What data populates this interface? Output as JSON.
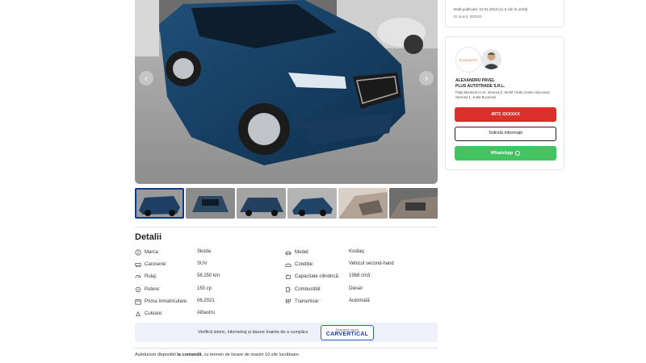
{
  "gallery": {
    "prev_icon": "chevron-left-icon",
    "next_icon": "chevron-right-icon",
    "prev_glyph": "‹",
    "next_glyph": "›",
    "thumbnail_count": 6
  },
  "details": {
    "title": "Detalii",
    "specs": [
      {
        "icon": "info-icon",
        "label": "Marca:",
        "value": "Skoda"
      },
      {
        "icon": "car-icon",
        "label": "Model:",
        "value": "Kodiaq"
      },
      {
        "icon": "car-body-icon",
        "label": "Caroserie:",
        "value": "SUV"
      },
      {
        "icon": "condition-icon",
        "label": "Condiție:",
        "value": "Vehicul second-hand"
      },
      {
        "icon": "odometer-icon",
        "label": "Rulaj:",
        "value": "56.250 km"
      },
      {
        "icon": "engine-icon",
        "label": "Capacitate cilindrică:",
        "value": "1968 cm3"
      },
      {
        "icon": "power-icon",
        "label": "Putere:",
        "value": "150 cp"
      },
      {
        "icon": "fuel-icon",
        "label": "Combustibil:",
        "value": "Diesel"
      },
      {
        "icon": "calendar-icon",
        "label": "Prima înmatriculare:",
        "value": "06.2021"
      },
      {
        "icon": "transmission-icon",
        "label": "Transmisie:",
        "value": "Automată"
      },
      {
        "icon": "color-icon",
        "label": "Culoare:",
        "value": "Albastru"
      }
    ]
  },
  "carvertical": {
    "text": "Verifică istoric, kilometraj și daune înainte de a cumpăra",
    "button_small": "Descarcă raport",
    "button_brand": "CARVERTICAL"
  },
  "delivery_note": {
    "before": "Autoturism disponibil ",
    "bold": "la comandă",
    "after": ", cu termen de livrare de maxim 10 zile lucrătoare."
  },
  "publication": {
    "date_text": "Dată publicare: 03.01.2023 (cu 6 zile în urmă)",
    "id_text": "ID anunț: 302833"
  },
  "dealer": {
    "logo_text": "PLUS AUTO",
    "name": "ALEXANDRU PAVEL",
    "company": "PLUS AUTOTRADE S.R.L.",
    "address": "Piața Montreal nr.10, Intrarea E, World Trade Center, București Sectorul 1, Județ București",
    "phone_label": "4072 XXXXXX",
    "request_label": "Solicită informații",
    "whatsapp_label": "WhatsApp",
    "whatsapp_icon": "whatsapp-icon"
  },
  "colors": {
    "phone_button": "#d9302c",
    "whatsapp_button": "#45c261",
    "carvertical_accent": "#1f3fa8"
  }
}
